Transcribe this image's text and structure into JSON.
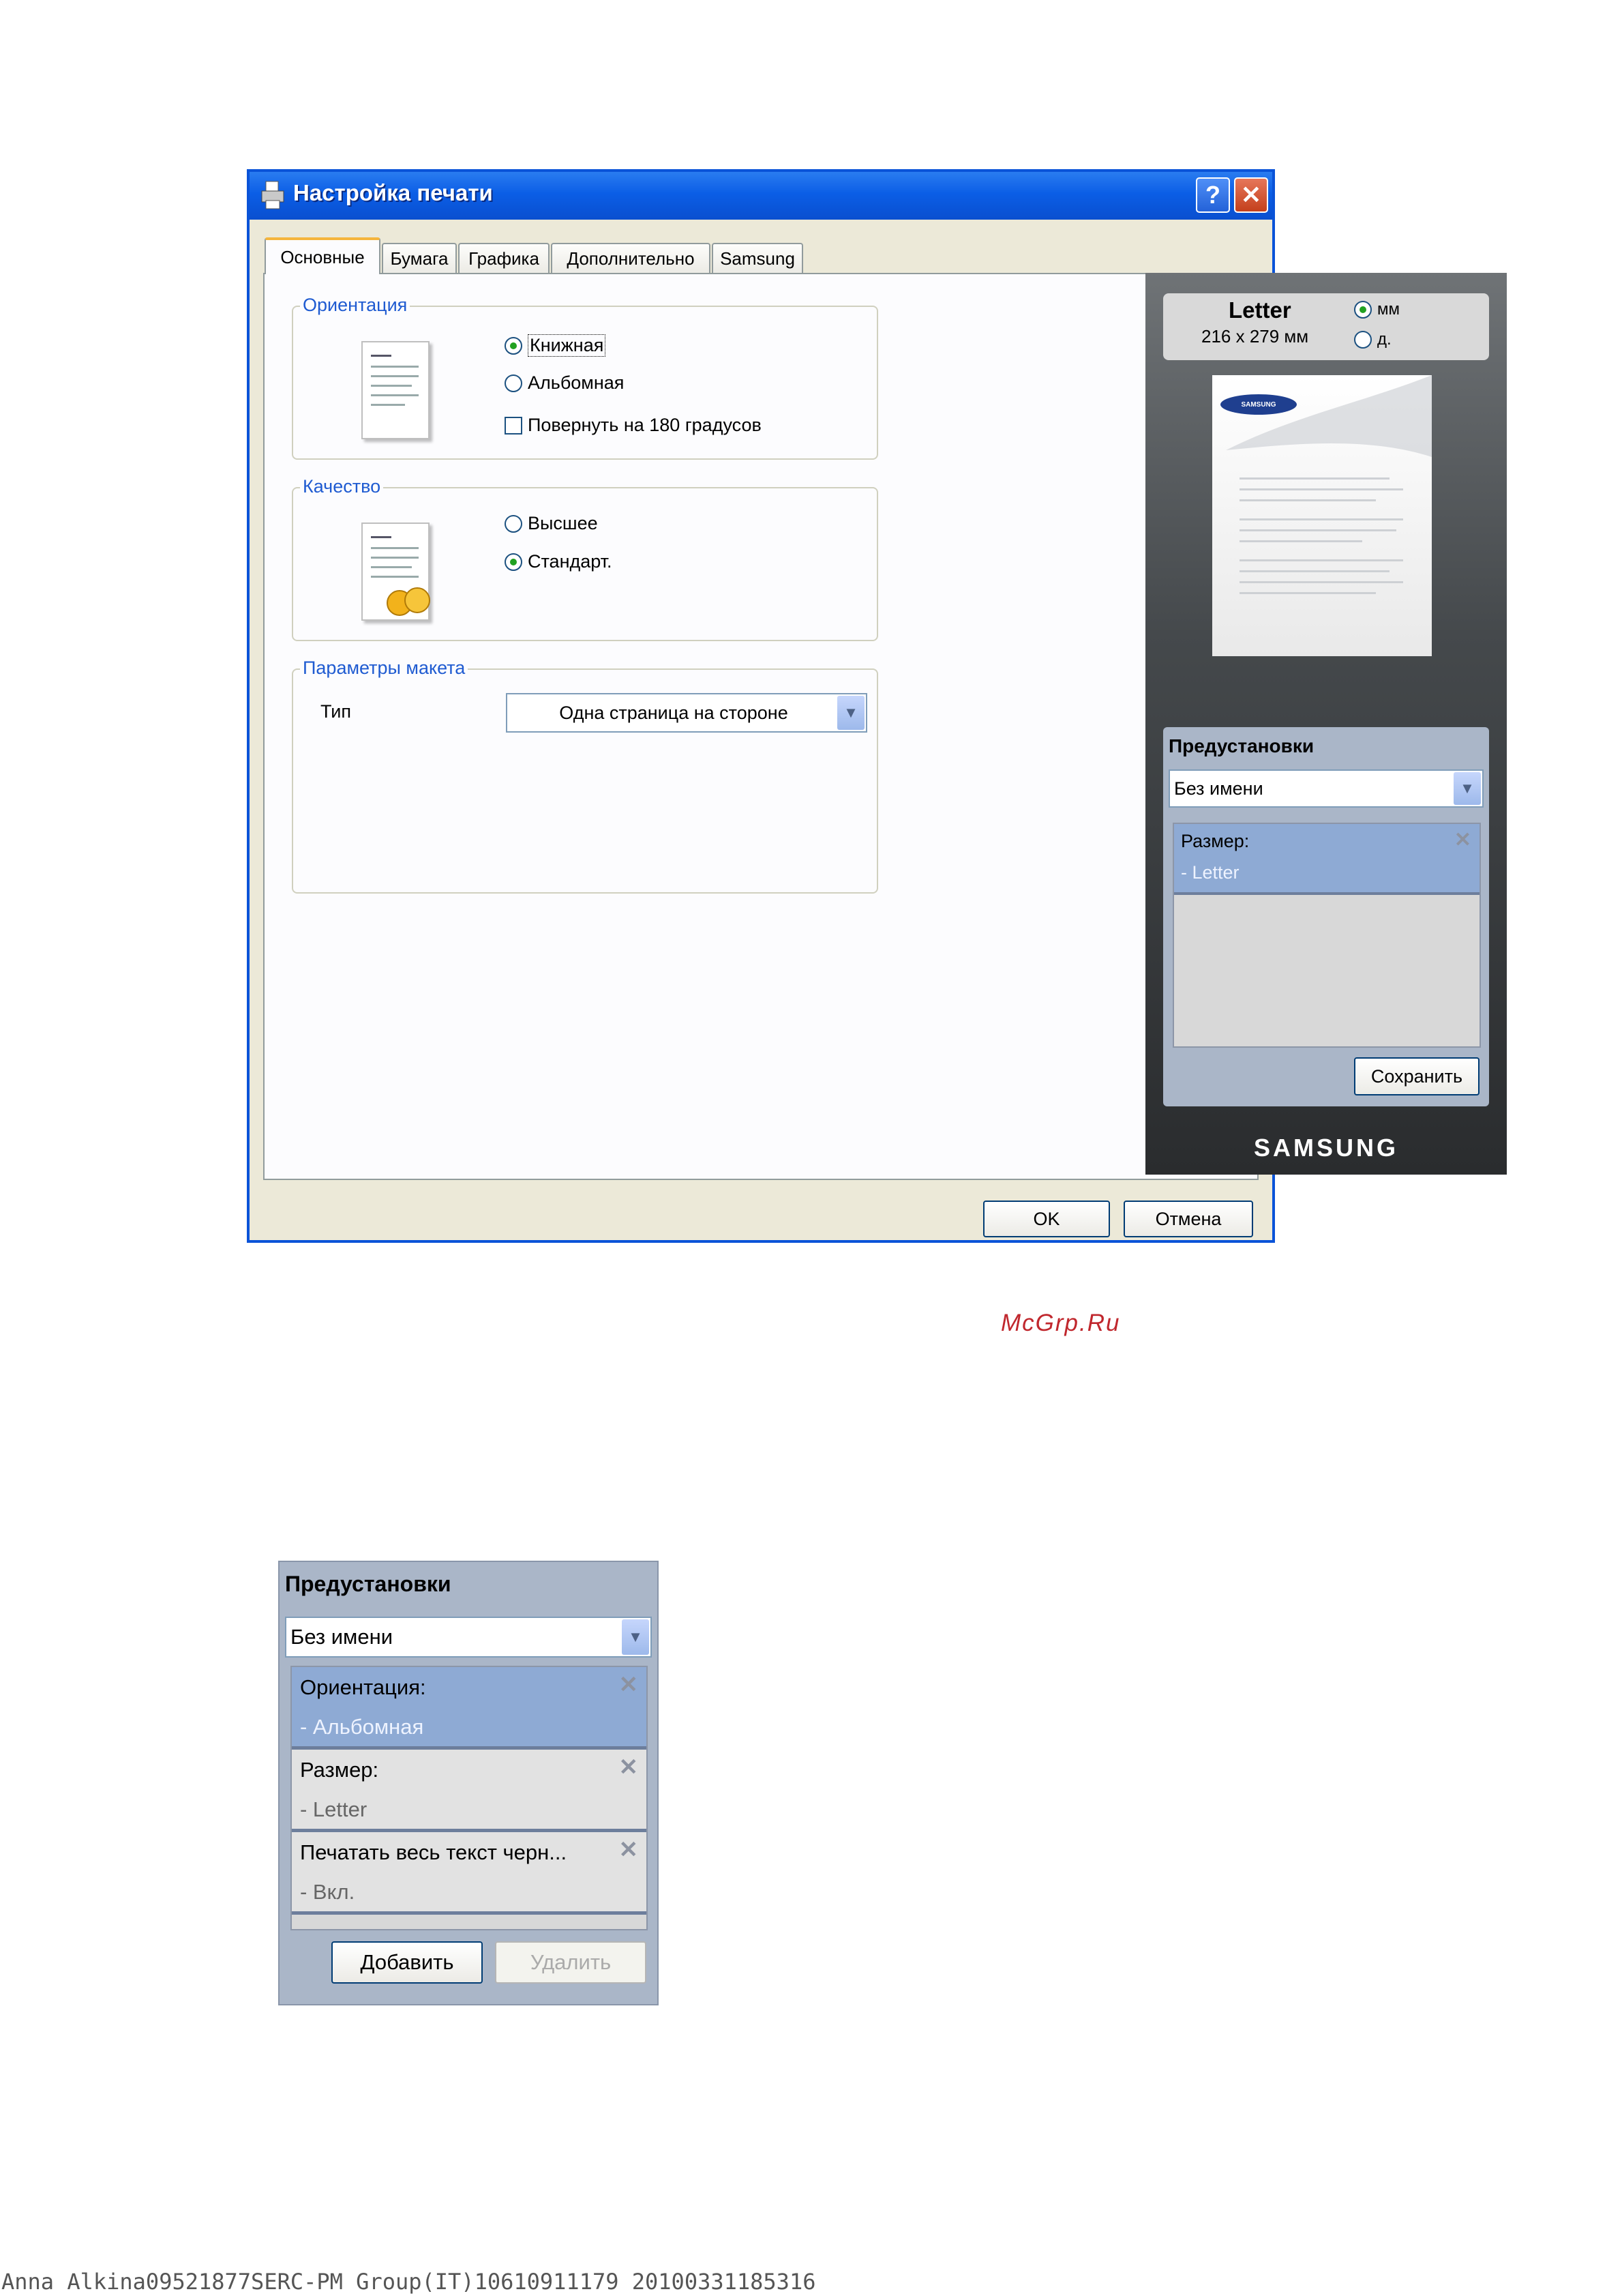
{
  "dialog": {
    "title": "Настройка печати",
    "help_label": "?",
    "close_label": "✕",
    "tabs": [
      {
        "label": "Основные",
        "active": true
      },
      {
        "label": "Бумага"
      },
      {
        "label": "Графика"
      },
      {
        "label": "Дополнительно"
      },
      {
        "label": "Samsung"
      }
    ],
    "orientation": {
      "label": "Ориентация",
      "portrait": "Книжная",
      "landscape": "Альбомная",
      "rotate": "Повернуть на 180 градусов"
    },
    "quality": {
      "label": "Качество",
      "best": "Высшее",
      "standard": "Стандарт."
    },
    "layout": {
      "label": "Параметры макета",
      "type_label": "Тип",
      "type_value": "Одна страница на стороне"
    },
    "watermark": "McGrp.Ru",
    "paper": {
      "name": "Letter",
      "dims": "216 x 279 мм",
      "unit_mm": "мм",
      "unit_in": "д."
    },
    "presets": {
      "title": "Предустановки",
      "selected": "Без имени",
      "items": [
        {
          "key": "Размер:",
          "value": "- Letter"
        }
      ],
      "save_label": "Сохранить"
    },
    "brand": "SAMSUNG",
    "ok_label": "OK",
    "cancel_label": "Отмена"
  },
  "presets_panel": {
    "title": "Предустановки",
    "selected": "Без имени",
    "items": [
      {
        "key": "Ориентация:",
        "value": "- Альбомная"
      },
      {
        "key": "Размер:",
        "value": "- Letter"
      },
      {
        "key": "Печатать весь текст черн...",
        "value": "- Вкл."
      }
    ],
    "add_label": "Добавить",
    "delete_label": "Удалить"
  },
  "footer_text": "Anna Alkina09521877SERC-PM Group(IT)10610911179 20100331185316",
  "colors": {
    "titlebar": "#0b5ee6",
    "group_label": "#1f5bd1",
    "watermark": "#c0272d",
    "preset_selected": "#8eaad4"
  }
}
